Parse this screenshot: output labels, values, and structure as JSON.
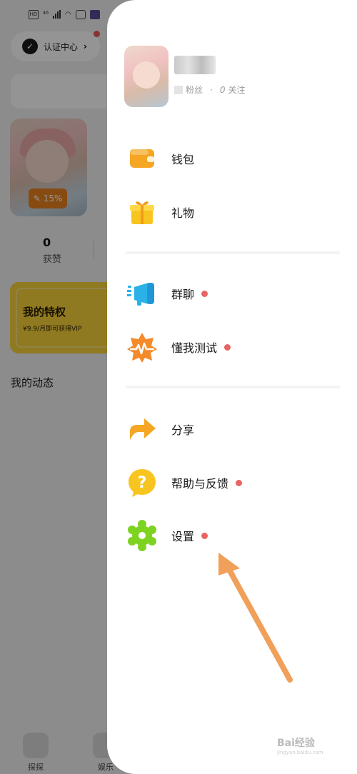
{
  "status_bar": {
    "hd": "HD",
    "net": "⁴⁶"
  },
  "background": {
    "cert_label": "认证中心",
    "avatar_badge": "15%",
    "likes_count": "0",
    "likes_label": "获赞",
    "vip_title": "我的特权",
    "vip_subtitle": "¥9.9/月即可获得VIP",
    "moments_label": "我的动态",
    "tabs": [
      {
        "label": "探探",
        "icon": "plus-square-icon"
      },
      {
        "label": "娱乐",
        "icon": "media-icon"
      }
    ]
  },
  "drawer": {
    "profile": {
      "fans_label": "粉丝",
      "follow_count": "0",
      "follow_label": "关注",
      "separator": "·"
    },
    "menu": [
      {
        "id": "wallet",
        "label": "钱包",
        "icon": "wallet-icon",
        "dot": false
      },
      {
        "id": "gift",
        "label": "礼物",
        "icon": "gift-icon",
        "dot": false
      },
      {
        "id": "group-chat",
        "label": "群聊",
        "icon": "megaphone-icon",
        "dot": true
      },
      {
        "id": "test",
        "label": "懂我测试",
        "icon": "pulse-star-icon",
        "dot": true
      },
      {
        "id": "share",
        "label": "分享",
        "icon": "share-arrow-icon",
        "dot": false
      },
      {
        "id": "help",
        "label": "帮助与反馈",
        "icon": "question-bubble-icon",
        "dot": true
      },
      {
        "id": "settings",
        "label": "设置",
        "icon": "gear-icon",
        "dot": true
      }
    ]
  },
  "watermark": {
    "text": "Bai经验",
    "sub": "jingyan.baidu.com"
  },
  "colors": {
    "accent_orange": "#f5a623",
    "dot_red": "#e86464",
    "vip_yellow": "#f7d23c",
    "annotation_arrow": "#f0a05a"
  }
}
